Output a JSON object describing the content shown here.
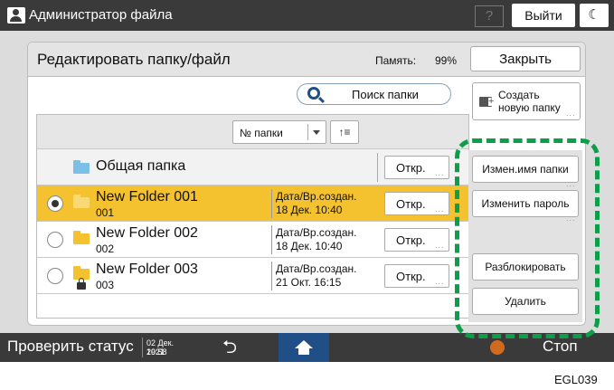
{
  "topbar": {
    "title": "Администратор файла",
    "help": "?",
    "logout": "Выйти",
    "moon": "☾"
  },
  "panel": {
    "title": "Редактировать папку/файл",
    "memory_label": "Память:",
    "memory_value": "99%",
    "close": "Закрыть",
    "search": "Поиск папки",
    "create_line1": "Создать",
    "create_line2": "новую папку",
    "sort_by": "№ папки",
    "order_icon": "↑≡"
  },
  "rows": [
    {
      "name": "Общая папка",
      "open": "Откр.",
      "type": "shared"
    },
    {
      "name": "New Folder 001",
      "number": "001",
      "date_label": "Дата/Вр.создан.",
      "date": "18 Дек.  10:40",
      "open": "Откр.",
      "selected": true
    },
    {
      "name": "New Folder 002",
      "number": "002",
      "date_label": "Дата/Вр.создан.",
      "date": "18 Дек.  10:40",
      "open": "Откр.",
      "selected": false
    },
    {
      "name": "New Folder 003",
      "number": "003",
      "date_label": "Дата/Вр.создан.",
      "date": "21 Окт.   16:15",
      "open": "Откр.",
      "selected": false,
      "locked": true
    }
  ],
  "side_buttons": {
    "rename": "Измен.имя папки",
    "password": "Изменить пароль",
    "unlock": "Разблокировать",
    "delete": "Удалить"
  },
  "bottombar": {
    "status": "Проверить статус",
    "date": "02 Дек. 2021",
    "time": "19:58",
    "stop": "Стоп"
  },
  "caption": "EGL039",
  "colors": {
    "selected_row": "#f5c22f",
    "highlight_dashed": "#0c9e48",
    "home": "#1f4f86"
  },
  "icons": [
    "user-icon",
    "search-icon",
    "new-folder-icon",
    "folder-icon",
    "lock-icon",
    "back-icon",
    "home-icon",
    "stop-icon"
  ]
}
